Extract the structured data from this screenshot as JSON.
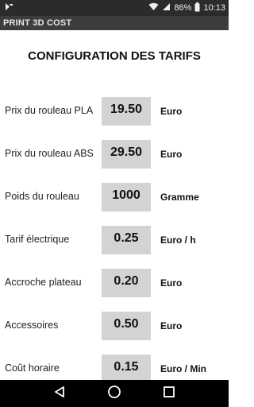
{
  "status_bar": {
    "battery": "86%",
    "time": "10:13"
  },
  "app": {
    "title": "PRINT 3D COST"
  },
  "page": {
    "heading": "CONFIGURATION DES TARIFS"
  },
  "rows": [
    {
      "label": "Prix du rouleau PLA",
      "value": "19.50",
      "unit": "Euro"
    },
    {
      "label": "Prix du rouleau ABS",
      "value": "29.50",
      "unit": "Euro"
    },
    {
      "label": "Poids du rouleau",
      "value": "1000",
      "unit": "Gramme"
    },
    {
      "label": "Tarif électrique",
      "value": "0.25",
      "unit": "Euro / h"
    },
    {
      "label": "Accroche plateau",
      "value": "0.20",
      "unit": "Euro"
    },
    {
      "label": "Accessoires",
      "value": "0.50",
      "unit": "Euro"
    },
    {
      "label": "Coût horaire",
      "value": "0.15",
      "unit": "Euro / Min"
    }
  ],
  "icons": {
    "status_left": "app-notification-icon",
    "wifi": "wifi-icon",
    "signal": "signal-icon",
    "battery": "battery-icon",
    "back": "back-icon",
    "home": "home-icon",
    "recents": "recents-icon"
  }
}
